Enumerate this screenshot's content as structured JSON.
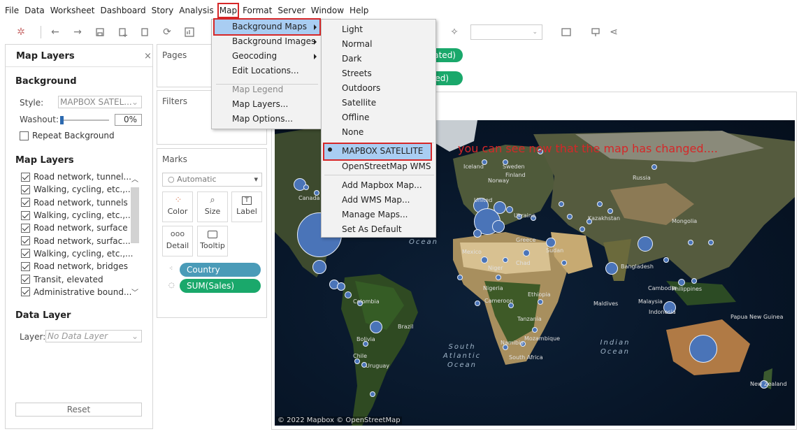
{
  "menubar": [
    "File",
    "Data",
    "Worksheet",
    "Dashboard",
    "Story",
    "Analysis",
    "Map",
    "Format",
    "Server",
    "Window",
    "Help"
  ],
  "left": {
    "title": "Map Layers",
    "close": "×",
    "background_heading": "Background",
    "style_label": "Style:",
    "style_value": "MAPBOX SATEL...",
    "washout_label": "Washout:",
    "washout_value": "0%",
    "washout_level": 0,
    "repeat_label": "Repeat Background",
    "map_layers_heading": "Map Layers",
    "layers": [
      "Road network, tunnel...",
      "Walking, cycling, etc.,...",
      "Road network, tunnels",
      "Walking, cycling, etc.,...",
      "Road network, surface",
      "Road network, surfac...",
      "Walking, cycling, etc.,...",
      "Road network, bridges",
      "Transit, elevated",
      "Administrative bound..."
    ],
    "data_layer_heading": "Data Layer",
    "layer_label": "Layer:",
    "layer_value": "No Data Layer",
    "reset": "Reset"
  },
  "shelves": {
    "pages": "Pages",
    "filters": "Filters",
    "marks": "Marks",
    "mark_type": "Automatic",
    "buttons": [
      "Color",
      "Size",
      "Label",
      "Detail",
      "Tooltip"
    ],
    "pills": {
      "country": "Country",
      "sales": "SUM(Sales)"
    },
    "rows_fragment": "ated)",
    "cols_fragment": "ed)"
  },
  "map_menu": {
    "items": [
      "Background Maps",
      "Background Images",
      "Geocoding",
      "Edit Locations...",
      "Map Legend",
      "Map Layers...",
      "Map Options..."
    ]
  },
  "bg_submenu": {
    "items": [
      "Light",
      "Normal",
      "Dark",
      "Streets",
      "Outdoors",
      "Satellite",
      "Offline",
      "None",
      "MAPBOX SATELLITE",
      "OpenStreetMap WMS",
      "Add Mapbox Map...",
      "Add WMS Map...",
      "Manage Maps...",
      "Set As Default"
    ],
    "selected": "MAPBOX SATELLITE"
  },
  "annotation": "you can see now that the map has changed....",
  "map": {
    "credit": "© 2022 Mapbox © OpenStreetMap",
    "labels": [
      "Iceland",
      "Sweden",
      "Finland",
      "Norway",
      "Russia",
      "Canada",
      "United",
      "Kazakhstan",
      "Mongolia",
      "Ukraine",
      "Greece",
      "Mexico",
      "Niger",
      "Chad",
      "Sudan",
      "Nigeria",
      "Cameroon",
      "Ethiopia",
      "Tanzania",
      "Bangladesh",
      "Cambodia",
      "Philippines",
      "Malaysia",
      "Indonesia",
      "Maldives",
      "Colombia",
      "Brazil",
      "Bolivia",
      "Chile",
      "Uruguay",
      "Namibia",
      "South Africa",
      "Mozambique",
      "Papua New Guinea",
      "New Zealand"
    ],
    "oceans": [
      "Ocean",
      "South Atlantic Ocean",
      "Indian Ocean"
    ]
  },
  "colors": {
    "accent_red": "#d62728",
    "pill_blue": "#4a9bb8",
    "pill_green": "#1aa86b",
    "mark_blue": "#4a74b8",
    "menu_highlight": "#a9cdf2"
  }
}
